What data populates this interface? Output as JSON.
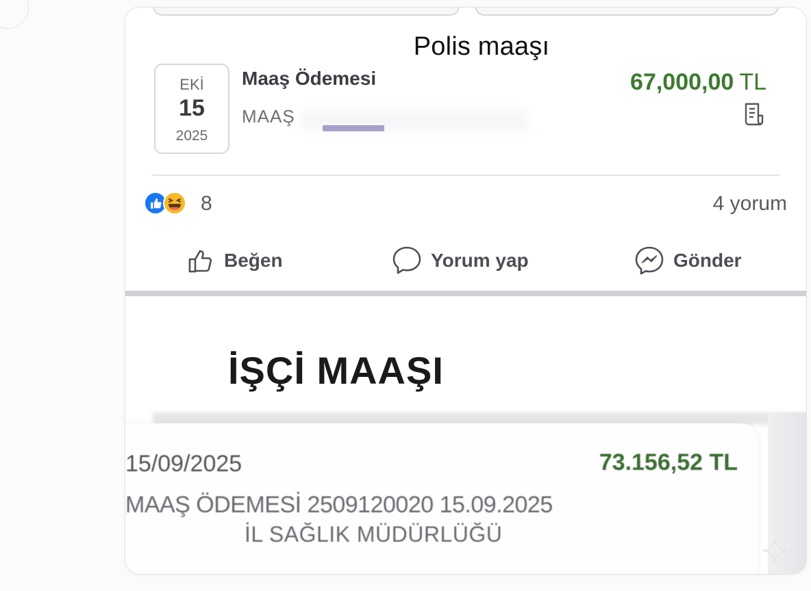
{
  "post": {
    "title": "Polis maaşı",
    "transaction": {
      "date_month": "EKİ",
      "date_day": "15",
      "date_year": "2025",
      "title": "Maaş Ödemesi",
      "subtitle": "MAAŞ",
      "amount": "67,000,00",
      "currency": "TL"
    },
    "reactions": {
      "count": "8",
      "comments": "4 yorum"
    },
    "actions": {
      "like": "Beğen",
      "comment": "Yorum yap",
      "send": "Gönder"
    }
  },
  "second": {
    "title": "İŞÇİ MAAŞI",
    "date": "15/09/2025",
    "amount": "73.156,52 TL",
    "description": "MAAŞ ÖDEMESİ 2509120020 15.09.2025",
    "institution": "İL SAĞLIK MÜDÜRLÜĞÜ"
  },
  "colors": {
    "amount_green": "#3d7a2e",
    "like_blue": "#1877f2",
    "haha_yellow": "#f7b928"
  },
  "icons": [
    "receipt-icon",
    "like-reaction-icon",
    "haha-reaction-icon",
    "thumbs-up-icon",
    "comment-bubble-icon",
    "messenger-icon",
    "sparkle-icon"
  ]
}
